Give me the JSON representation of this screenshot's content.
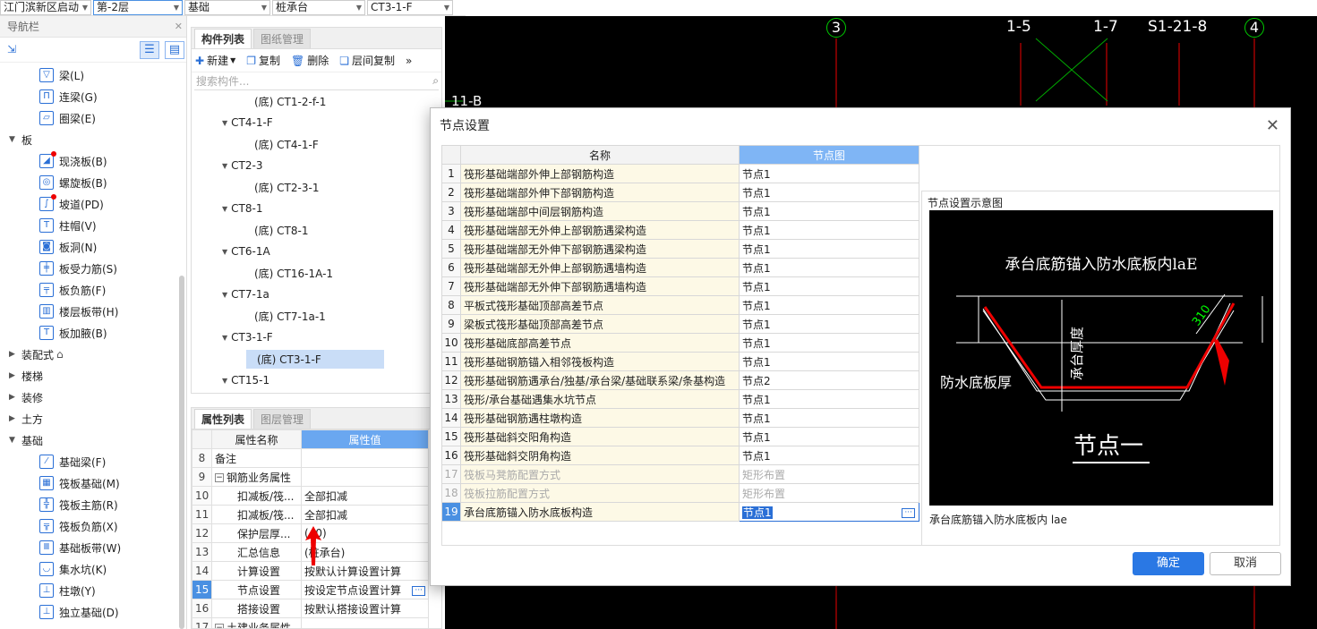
{
  "topbar": {
    "project": "江门滨新区启动",
    "floor": "第-2层",
    "category": "基础",
    "type": "桩承台",
    "item": "CT3-1-F"
  },
  "nav": {
    "title": "导航栏",
    "items": [
      {
        "label": "梁(L)",
        "level": 2,
        "icon": "beam-icon",
        "glyph": "▽"
      },
      {
        "label": "连梁(G)",
        "level": 2,
        "icon": "coupling-beam-icon",
        "glyph": "П"
      },
      {
        "label": "圈梁(E)",
        "level": 2,
        "icon": "ring-beam-icon",
        "glyph": "▱"
      },
      {
        "label": "板",
        "level": 1,
        "expanded": true
      },
      {
        "label": "现浇板(B)",
        "level": 2,
        "icon": "cast-slab-icon",
        "glyph": "◢",
        "dot": true
      },
      {
        "label": "螺旋板(B)",
        "level": 2,
        "icon": "spiral-slab-icon",
        "glyph": "◎"
      },
      {
        "label": "坡道(PD)",
        "level": 2,
        "icon": "ramp-icon",
        "glyph": "∫",
        "dot": true
      },
      {
        "label": "柱帽(V)",
        "level": 2,
        "icon": "column-cap-icon",
        "glyph": "T"
      },
      {
        "label": "板洞(N)",
        "level": 2,
        "icon": "slab-hole-icon",
        "glyph": "◙"
      },
      {
        "label": "板受力筋(S)",
        "level": 2,
        "icon": "slab-main-rebar-icon",
        "glyph": "╪"
      },
      {
        "label": "板负筋(F)",
        "level": 2,
        "icon": "slab-negative-rebar-icon",
        "glyph": "╤"
      },
      {
        "label": "楼层板带(H)",
        "level": 2,
        "icon": "floor-strip-icon",
        "glyph": "▥"
      },
      {
        "label": "板加腋(B)",
        "level": 2,
        "icon": "slab-haunch-icon",
        "glyph": "T"
      },
      {
        "label": "装配式",
        "level": 1,
        "expanded": false,
        "extra": "⌂"
      },
      {
        "label": "楼梯",
        "level": 1,
        "expanded": false
      },
      {
        "label": "装修",
        "level": 1,
        "expanded": false
      },
      {
        "label": "土方",
        "level": 1,
        "expanded": false
      },
      {
        "label": "基础",
        "level": 1,
        "expanded": true
      },
      {
        "label": "基础梁(F)",
        "level": 2,
        "icon": "foundation-beam-icon",
        "glyph": "⁄"
      },
      {
        "label": "筏板基础(M)",
        "level": 2,
        "icon": "raft-foundation-icon",
        "glyph": "▦"
      },
      {
        "label": "筏板主筋(R)",
        "level": 2,
        "icon": "raft-main-rebar-icon",
        "glyph": "╬"
      },
      {
        "label": "筏板负筋(X)",
        "level": 2,
        "icon": "raft-negative-rebar-icon",
        "glyph": "╦"
      },
      {
        "label": "基础板带(W)",
        "level": 2,
        "icon": "foundation-strip-icon",
        "glyph": "Ⅲ"
      },
      {
        "label": "集水坑(K)",
        "level": 2,
        "icon": "sump-pit-icon",
        "glyph": "◡"
      },
      {
        "label": "柱墩(Y)",
        "level": 2,
        "icon": "column-pier-icon",
        "glyph": "⊥"
      },
      {
        "label": "独立基础(D)",
        "level": 2,
        "icon": "isolated-foundation-icon",
        "glyph": "⊥"
      }
    ]
  },
  "comp": {
    "tab1": "构件列表",
    "tab2": "图纸管理",
    "new": "新建",
    "copy": "复制",
    "delete": "删除",
    "floor_copy": "层间复制",
    "search_placeholder": "搜索构件...",
    "items": [
      {
        "label": "(底) CT1-2-f-1",
        "kind": "c"
      },
      {
        "label": "CT4-1-F",
        "kind": "p"
      },
      {
        "label": "(底) CT4-1-F",
        "kind": "c"
      },
      {
        "label": "CT2-3",
        "kind": "p"
      },
      {
        "label": "(底) CT2-3-1",
        "kind": "c"
      },
      {
        "label": "CT8-1",
        "kind": "p"
      },
      {
        "label": "(底) CT8-1",
        "kind": "c"
      },
      {
        "label": "CT6-1A",
        "kind": "p"
      },
      {
        "label": "(底) CT16-1A-1",
        "kind": "c"
      },
      {
        "label": "CT7-1a",
        "kind": "p"
      },
      {
        "label": "(底) CT7-1a-1",
        "kind": "c"
      },
      {
        "label": "CT3-1-F",
        "kind": "p"
      },
      {
        "label": "(底) CT3-1-F",
        "kind": "c",
        "selected": true
      },
      {
        "label": "CT15-1",
        "kind": "p"
      }
    ]
  },
  "prop": {
    "tab1": "属性列表",
    "tab2": "图层管理",
    "col_name": "属性名称",
    "col_value": "属性值",
    "rows": [
      {
        "n": "8",
        "name": "备注",
        "value": "",
        "indent": 0
      },
      {
        "n": "9",
        "name": "钢筋业务属性",
        "value": "",
        "indent": 0,
        "group": true
      },
      {
        "n": "10",
        "name": "扣减板/筏...",
        "value": "全部扣减",
        "indent": 1
      },
      {
        "n": "11",
        "name": "扣减板/筏...",
        "value": "全部扣减",
        "indent": 1
      },
      {
        "n": "12",
        "name": "保护层厚...",
        "value": "(40)",
        "indent": 1
      },
      {
        "n": "13",
        "name": "汇总信息",
        "value": "(桩承台)",
        "indent": 1
      },
      {
        "n": "14",
        "name": "计算设置",
        "value": "按默认计算设置计算",
        "indent": 1
      },
      {
        "n": "15",
        "name": "节点设置",
        "value": "按设定节点设置计算",
        "indent": 1,
        "hl": true
      },
      {
        "n": "16",
        "name": "搭接设置",
        "value": "按默认搭接设置计算",
        "indent": 1
      },
      {
        "n": "17",
        "name": "土建业务属性",
        "value": "",
        "indent": 0,
        "group": true
      }
    ]
  },
  "cad": {
    "axes": [
      {
        "label": "3",
        "bubble": true
      },
      {
        "label": "1-5"
      },
      {
        "label": "1-7"
      },
      {
        "label": "S1-21-8"
      },
      {
        "label": "4",
        "bubble": true
      }
    ],
    "side_label": "11-B"
  },
  "dialog": {
    "title": "节点设置",
    "col_name": "名称",
    "col_node": "节点图",
    "rows": [
      {
        "n": "1",
        "name": "筏形基础端部外伸上部钢筋构造",
        "node": "节点1"
      },
      {
        "n": "2",
        "name": "筏形基础端部外伸下部钢筋构造",
        "node": "节点1"
      },
      {
        "n": "3",
        "name": "筏形基础端部中间层钢筋构造",
        "node": "节点1"
      },
      {
        "n": "4",
        "name": "筏形基础端部无外伸上部钢筋遇梁构造",
        "node": "节点1"
      },
      {
        "n": "5",
        "name": "筏形基础端部无外伸下部钢筋遇梁构造",
        "node": "节点1"
      },
      {
        "n": "6",
        "name": "筏形基础端部无外伸上部钢筋遇墙构造",
        "node": "节点1"
      },
      {
        "n": "7",
        "name": "筏形基础端部无外伸下部钢筋遇墙构造",
        "node": "节点1"
      },
      {
        "n": "8",
        "name": "平板式筏形基础顶部高差节点",
        "node": "节点1"
      },
      {
        "n": "9",
        "name": "梁板式筏形基础顶部高差节点",
        "node": "节点1"
      },
      {
        "n": "10",
        "name": "筏形基础底部高差节点",
        "node": "节点1"
      },
      {
        "n": "11",
        "name": "筏形基础钢筋锚入相邻筏板构造",
        "node": "节点1"
      },
      {
        "n": "12",
        "name": "筏形基础钢筋遇承台/独基/承台梁/基础联系梁/条基构造",
        "node": "节点2"
      },
      {
        "n": "13",
        "name": "筏形/承台基础遇集水坑节点",
        "node": "节点1"
      },
      {
        "n": "14",
        "name": "筏形基础钢筋遇柱墩构造",
        "node": "节点1"
      },
      {
        "n": "15",
        "name": "筏形基础斜交阳角构造",
        "node": "节点1"
      },
      {
        "n": "16",
        "name": "筏形基础斜交阴角构造",
        "node": "节点1"
      },
      {
        "n": "17",
        "name": "筏板马凳筋配置方式",
        "node": "矩形布置",
        "disabled": true
      },
      {
        "n": "18",
        "name": "筏板拉筋配置方式",
        "node": "矩形布置",
        "disabled": true
      },
      {
        "n": "19",
        "name": "承台底筋锚入防水底板构造",
        "node": "节点1",
        "current": true
      }
    ],
    "preview_title": "节点设置示意图",
    "preview_img": {
      "top_text": "承台底筋锚入防水底板内laE",
      "left_text": "防水底板厚",
      "vert_text": "承台厚度",
      "dim": "310",
      "node_title": "节点一"
    },
    "preview_caption": "承台底筋锚入防水底板内 lae",
    "ok": "确定",
    "cancel": "取消"
  }
}
